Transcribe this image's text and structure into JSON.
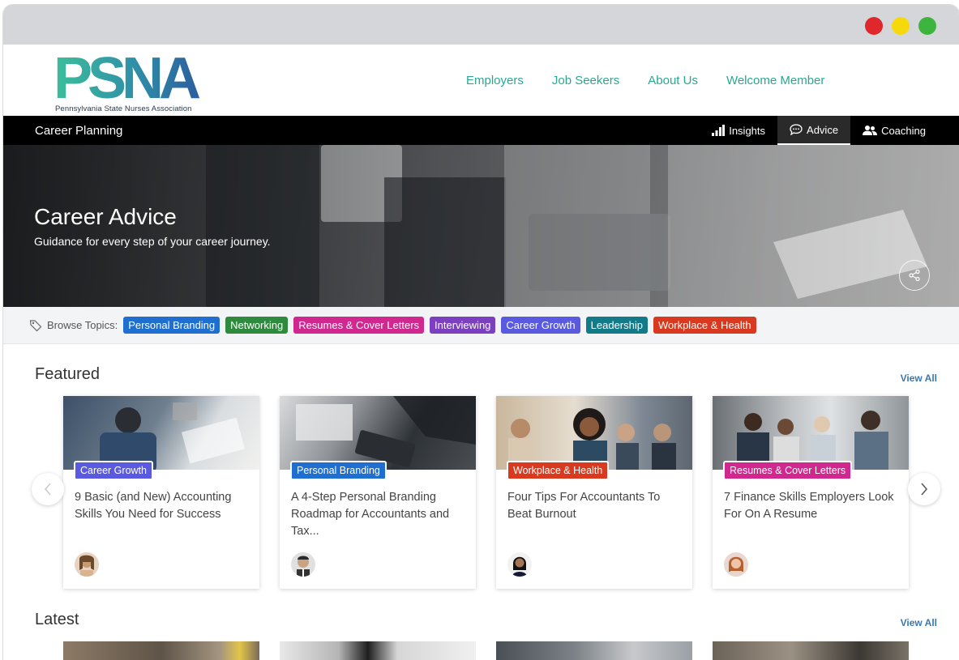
{
  "window": {
    "dots": [
      "#e0272b",
      "#f5d90a",
      "#3db43d"
    ]
  },
  "header": {
    "logo_text": "PSNA",
    "logo_tagline": "Pennsylvania State Nurses Association",
    "nav": [
      {
        "label": "Employers"
      },
      {
        "label": "Job Seekers"
      },
      {
        "label": "About Us"
      },
      {
        "label": "Welcome Member"
      }
    ],
    "accent": "#2aa693"
  },
  "subnav": {
    "title": "Career Planning",
    "tabs": [
      {
        "label": "Insights",
        "icon": "bar-chart-icon"
      },
      {
        "label": "Advice",
        "icon": "chat-bubble-icon",
        "active": true
      },
      {
        "label": "Coaching",
        "icon": "people-icon"
      }
    ]
  },
  "hero": {
    "title": "Career Advice",
    "subtitle": "Guidance for every step of your career journey."
  },
  "topics": {
    "label": "Browse Topics:",
    "items": [
      {
        "label": "Personal Branding",
        "color": "#1e6fd0"
      },
      {
        "label": "Networking",
        "color": "#2e8b3d"
      },
      {
        "label": "Resumes & Cover Letters",
        "color": "#d0288e"
      },
      {
        "label": "Interviewing",
        "color": "#7b3fbf"
      },
      {
        "label": "Career Growth",
        "color": "#5a5ae0"
      },
      {
        "label": "Leadership",
        "color": "#137a8a"
      },
      {
        "label": "Workplace & Health",
        "color": "#d93a1f"
      }
    ]
  },
  "featured": {
    "title": "Featured",
    "view_all": "View All",
    "cards": [
      {
        "badge": "Career Growth",
        "badge_color": "#5a5ae0",
        "title": "9 Basic (and New) Accounting Skills You Need for Success"
      },
      {
        "badge": "Personal Branding",
        "badge_color": "#1e6fd0",
        "title": "A 4-Step Personal Branding Roadmap for Accountants and Tax..."
      },
      {
        "badge": "Workplace & Health",
        "badge_color": "#d93a1f",
        "title": "Four Tips For Accountants To Beat Burnout"
      },
      {
        "badge": "Resumes & Cover Letters",
        "badge_color": "#d0288e",
        "title": "7 Finance Skills Employers Look For On A Resume"
      }
    ]
  },
  "latest": {
    "title": "Latest",
    "view_all": "View All"
  }
}
